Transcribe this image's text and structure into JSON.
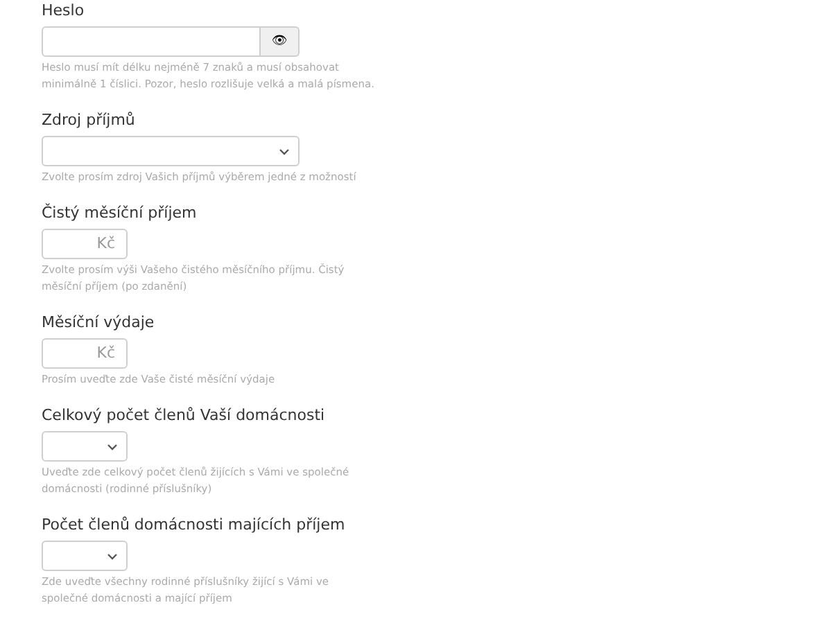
{
  "fields": [
    {
      "kind": "password",
      "label": "Heslo",
      "button": "👁",
      "help": "Heslo musí mít délku nejméně 7 znaků a musí obsahovat minimálně 1 číslici. Pozor, heslo rozlišuje velká a malá písmena."
    },
    {
      "kind": "select_wide",
      "label": "Zdroj příjmů",
      "help": "Zvolte prosím zdroj Vašich příjmů výběrem jedné z možností"
    },
    {
      "kind": "currency",
      "label": "Čistý měsíční příjem",
      "unit": "Kč",
      "help": "Zvolte prosím výši Vašeho čistého měsíčního příjmu. Čistý měsíční příjem (po zdanění)"
    },
    {
      "kind": "currency",
      "label": "Měsíční výdaje",
      "unit": "Kč",
      "help": "Prosím uveďte zde Vaše čisté měsíční výdaje"
    },
    {
      "kind": "select_small",
      "label": "Celkový počet členů Vaší domácnosti",
      "help": "Uveďte zde celkový počet členů žijících s Vámi ve společné domácnosti (rodinné příslušníky)"
    },
    {
      "kind": "select_small",
      "label": "Počet členů domácnosti majících příjem",
      "help": "Zde uveďte všechny rodinné příslušníky žijící s Vámi ve společné domácnosti a mající příjem"
    }
  ]
}
